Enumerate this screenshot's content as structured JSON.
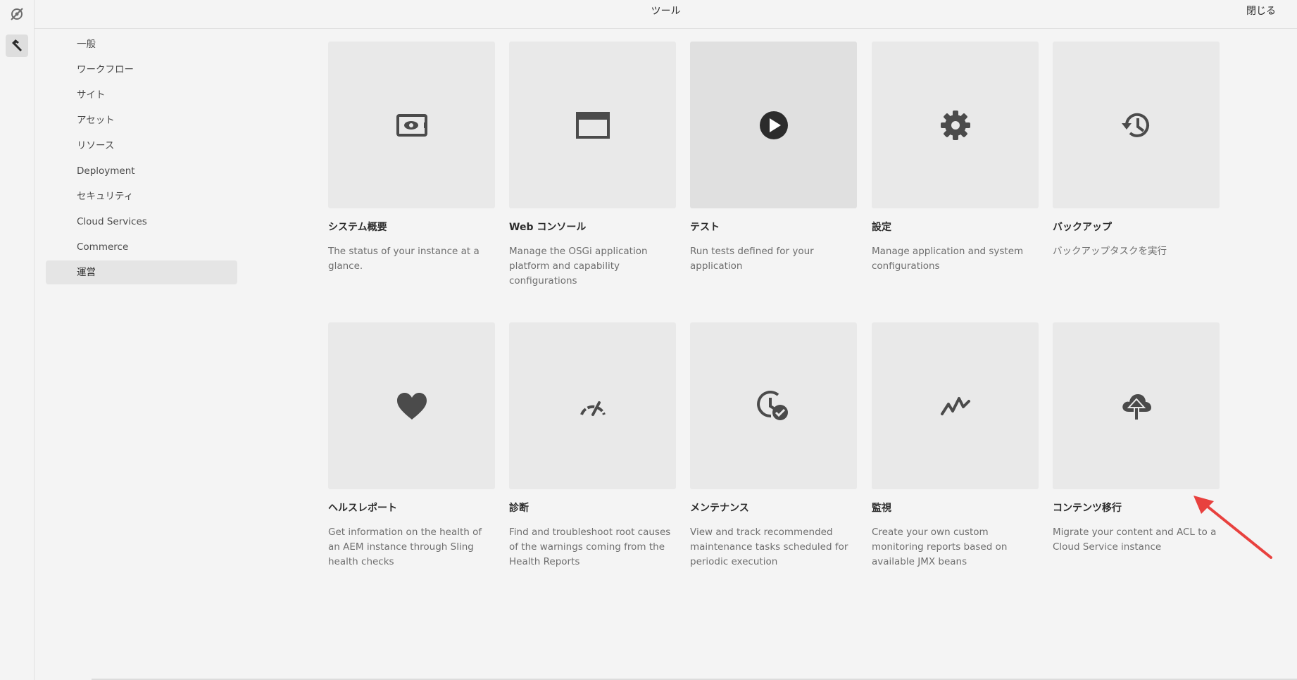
{
  "header": {
    "title": "ツール",
    "close_label": "閉じる"
  },
  "rail": {
    "logo_icon": "adobe-experience-icon",
    "tools_icon": "hammer-icon"
  },
  "nav": {
    "items": [
      {
        "label": "一般"
      },
      {
        "label": "ワークフロー"
      },
      {
        "label": "サイト"
      },
      {
        "label": "アセット"
      },
      {
        "label": "リソース"
      },
      {
        "label": "Deployment"
      },
      {
        "label": "セキュリティ"
      },
      {
        "label": "Cloud Services"
      },
      {
        "label": "Commerce"
      },
      {
        "label": "運営",
        "selected": true
      }
    ]
  },
  "cards": [
    {
      "icon": "preview-device-icon",
      "title": "システム概要",
      "description": "The status of your instance at a glance."
    },
    {
      "icon": "browser-window-icon",
      "title": "Web コンソール",
      "description": "Manage the OSGi application platform and capability configurations"
    },
    {
      "icon": "play-circle-icon",
      "title": "テスト",
      "description": "Run tests defined for your application"
    },
    {
      "icon": "gear-icon",
      "title": "設定",
      "description": "Manage application and system configurations"
    },
    {
      "icon": "history-icon",
      "title": "バックアップ",
      "description": "バックアップタスクを実行"
    },
    {
      "icon": "heart-icon",
      "title": "ヘルスレポート",
      "description": "Get information on the health of an AEM instance through Sling health checks"
    },
    {
      "icon": "speedometer-icon",
      "title": "診断",
      "description": "Find and troubleshoot root causes of the warnings coming from the Health Reports"
    },
    {
      "icon": "clock-check-icon",
      "title": "メンテナンス",
      "description": "View and track recommended maintenance tasks scheduled for periodic execution"
    },
    {
      "icon": "activity-graph-icon",
      "title": "監視",
      "description": "Create your own custom monitoring reports based on available JMX beans"
    },
    {
      "icon": "cloud-upload-icon",
      "title": "コンテンツ移行",
      "description": "Migrate your content and ACL to a Cloud Service instance"
    }
  ],
  "colors": {
    "background": "#f4f4f4",
    "card": "#e9e9e9",
    "icon": "#4b4b4b",
    "annotation_arrow": "#e8413e"
  }
}
